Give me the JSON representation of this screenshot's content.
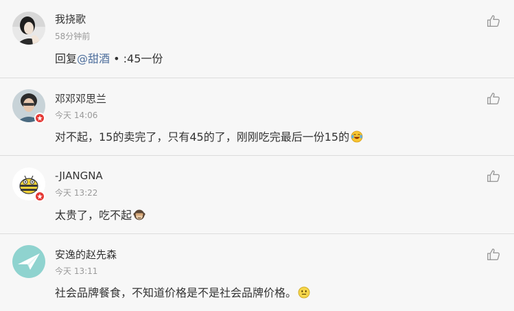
{
  "comments": [
    {
      "username": "我挠歌",
      "time": "58分钟前",
      "reply_prefix": "回复",
      "mention": "@甜酒",
      "text": " • :45一份",
      "has_badge": false
    },
    {
      "username": "邓邓邓思兰",
      "time": "今天 14:06",
      "text": "对不起，15的卖完了，只有45的了，刚刚吃完最后一份15的",
      "emoji": "laughing-tears",
      "has_badge": true
    },
    {
      "username": "-JIANGNA",
      "time": "今天 13:22",
      "text": "太贵了，吃不起",
      "emoji": "see-no-evil-monkey",
      "has_badge": true
    },
    {
      "username": "安逸的赵先森",
      "time": "今天 13:11",
      "text": "社会品牌餐食，不知道价格是不是社会品牌价格。",
      "emoji": "smile-face",
      "has_badge": false
    }
  ],
  "colors": {
    "background": "#f7f7f7",
    "divider": "#dcdcdc",
    "mention": "#4d6e9c",
    "badge": "#e53935",
    "username": "#333333",
    "time": "#999999"
  },
  "icons": {
    "like": "thumbs-up-icon",
    "badge": "verified-badge-icon"
  }
}
